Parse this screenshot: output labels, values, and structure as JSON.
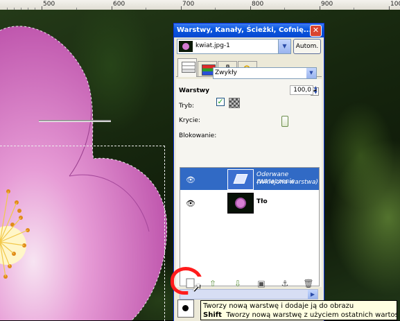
{
  "ruler": {
    "labels": [
      "500",
      "600",
      "700",
      "800",
      "900",
      "1000"
    ]
  },
  "dock": {
    "title": "Warstwy, Kanały, Ścieżki, Cofnię...",
    "close_glyph": "✕",
    "image_selector": {
      "value": "kwiat.jpg-1",
      "auto_button": "Autom."
    },
    "tabs": [
      "layers-tab",
      "channels-tab",
      "paths-tab",
      "undo-tab"
    ]
  },
  "layers_panel": {
    "title": "Warstwy",
    "mode_label": "Tryb:",
    "mode_value": "Zwykły",
    "opacity_label": "Krycie:",
    "opacity_value": "100,0",
    "opacity": 1.0,
    "lock_label": "Blokowanie:",
    "lock_checked": true,
    "layers": [
      {
        "name_line1": "Oderwane zaznaczenie",
        "name_line2": "(Wklejona warstwa)",
        "visible": true,
        "selected": true
      },
      {
        "name_line1": "Tło",
        "name_line2": "",
        "visible": true,
        "selected": false
      }
    ],
    "buttons": [
      "new-layer",
      "raise-layer",
      "lower-layer",
      "duplicate-layer",
      "anchor-layer",
      "delete-layer"
    ]
  },
  "tooltip": {
    "line1": "Tworzy nową warstwę i dodaje ją do obrazu",
    "shift_key": "Shift",
    "line2": "Tworzy nową warstwę z użyciem ostatnich wartości"
  },
  "colors": {
    "titlebar": "#0a58e0",
    "selection": "#316ac5",
    "annotation": "#ff1c1c",
    "tooltip_bg": "#ffffe1"
  }
}
